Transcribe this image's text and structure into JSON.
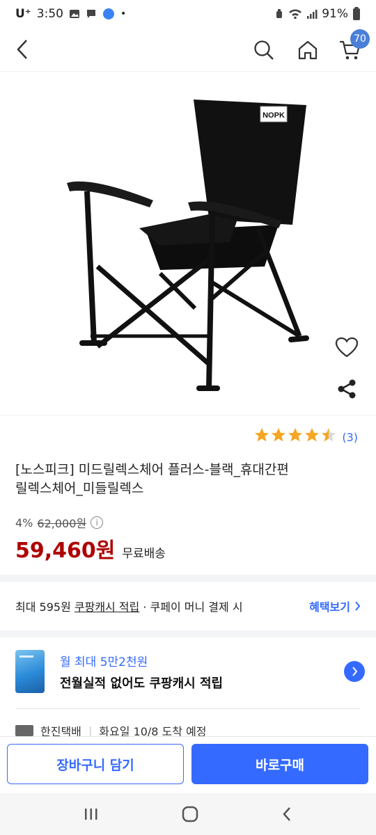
{
  "status_bar": {
    "carrier": "U⁺",
    "time": "3:50",
    "battery": "91%"
  },
  "header": {
    "cart_count": "70"
  },
  "product": {
    "image_label": "NOPK",
    "rating_count": "(3)",
    "rating_value": 4.5,
    "title_line1": "[노스피크] 미드릴렉스체어 플러스-블랙_휴대간편",
    "title_line2": "릴렉스체어_미들릴렉스",
    "discount": "4%",
    "original_price": "62,000원",
    "sale_price": "59,460원",
    "shipping": "무료배송"
  },
  "cash_benefit": {
    "prefix": "최대 595원 ",
    "cash_link": "쿠팡캐시 적립",
    "suffix": " · 쿠페이 머니 결제 시",
    "view_link": "혜택보기"
  },
  "card_promo": {
    "line1": "월 최대 5만2천원",
    "line2": "전월실적 없어도 쿠팡캐시 적립"
  },
  "delivery": {
    "carrier": "한진택배",
    "eta": "화요일 10/8 도착 예정"
  },
  "actions": {
    "add_to_cart": "장바구니 담기",
    "buy_now": "바로구매"
  },
  "colors": {
    "accent": "#346aff",
    "sale_price": "#ae0000",
    "star": "#f5a623"
  }
}
